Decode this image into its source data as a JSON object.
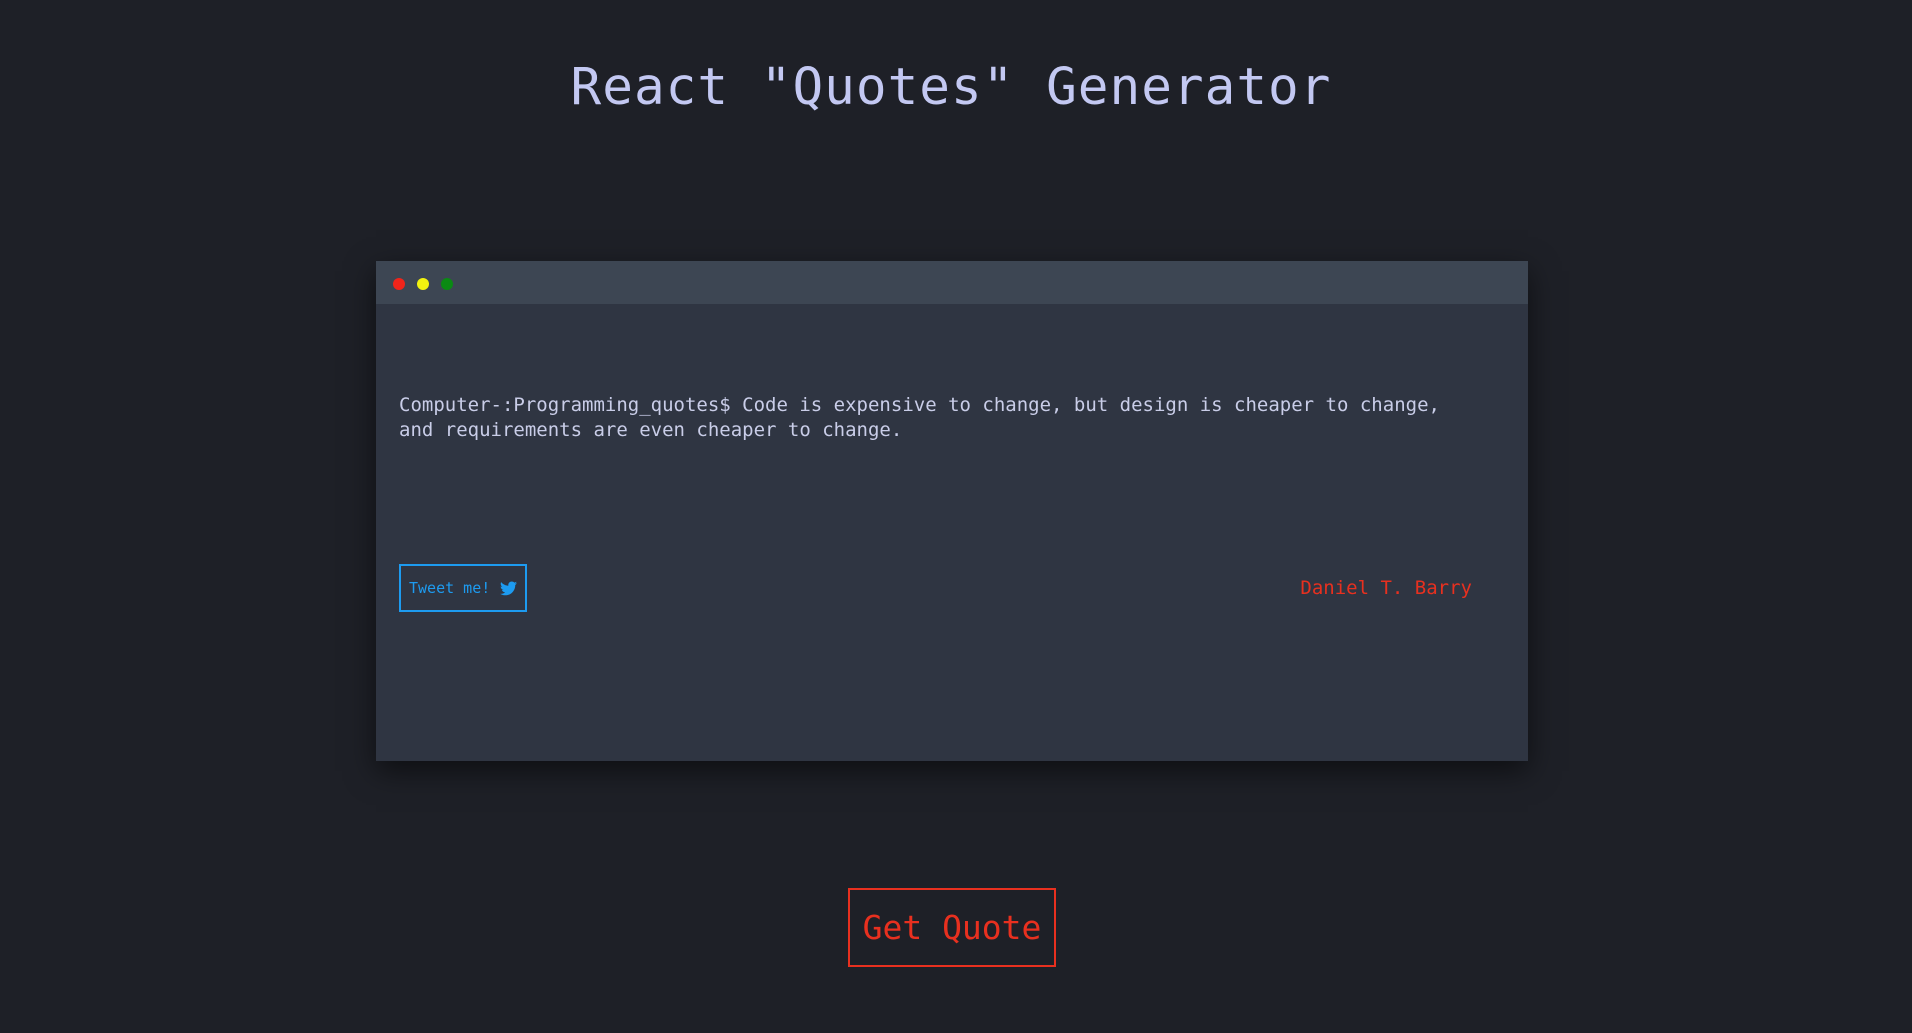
{
  "page": {
    "title": "React \"Quotes\" Generator"
  },
  "terminal": {
    "window_controls": [
      "red-dot",
      "yellow-dot",
      "green-dot"
    ],
    "quote_text": "Computer-:Programming_quotes$ Code is expensive to change, but design is cheaper to change, and requirements are even cheaper to change.",
    "author": "Daniel T. Barry",
    "tweet_button": {
      "label": "Tweet me!",
      "icon": "twitter-icon"
    }
  },
  "actions": {
    "get_quote_label": "Get Quote"
  },
  "colors": {
    "background": "#1e2027",
    "title": "#c3c8f2",
    "terminal_body": "#2f3542",
    "terminal_bar": "#3d4653",
    "quote_text": "#c9cde8",
    "tweet_accent": "#1d9bf0",
    "author_accent": "#e8301f",
    "dot_red": "#f0241a",
    "dot_yellow": "#f2f20f",
    "dot_green": "#0a8a13"
  }
}
